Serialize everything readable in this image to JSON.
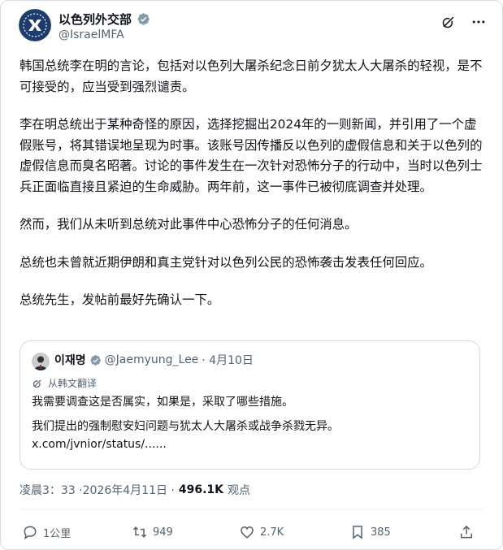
{
  "account": {
    "display_name": "以色列外交部",
    "handle": "@IsraelMFA",
    "verified_icon": "verified-badge-gray"
  },
  "icons": {
    "grok": "grok-icon",
    "more": "more-icon"
  },
  "post": {
    "paragraphs": [
      "韩国总统李在明的言论，包括对以色列大屠杀纪念日前夕犹太人大屠杀的轻视，是不可接受的，应当受到强烈谴责。",
      "李在明总统出于某种奇怪的原因，选择挖掘出2024年的一则新闻，并引用了一个虚假账号，将其错误地呈现为时事。该账号因传播反以色列的虚假信息和关于以色列的虚假信息而臭名昭著。讨论的事件发生在一次针对恐怖分子的行动中，当时以色列士兵正面临直接且紧迫的生命威胁。两年前，这一事件已被彻底调查并处理。",
      "然而，我们从未听到总统对此事件中心恐怖分子的任何消息。",
      "总统也未曾就近期伊朗和真主党针对以色列公民的恐怖袭击发表任何回应。",
      "总统先生，发帖前最好先确认一下。"
    ]
  },
  "quote": {
    "name": "이재명",
    "handle": "@Jaemyung_Lee",
    "date": "· 4月10日",
    "translated_label": "从韩文翻译",
    "lines": [
      "我需要调查这是否属实，如果是，采取了哪些措施。",
      "我们提出的强制慰安妇问题与犹太人大屠杀或战争杀戮无异。\nx.com/jvnior/status/......"
    ]
  },
  "meta": {
    "time_date": "凌晨3：33 ·2026年4月11日 ·",
    "views_count": "496.1K",
    "views_label": "观点"
  },
  "actions": {
    "reply": "1公里",
    "repost": "949",
    "like": "2.7K",
    "bookmark": "385"
  }
}
